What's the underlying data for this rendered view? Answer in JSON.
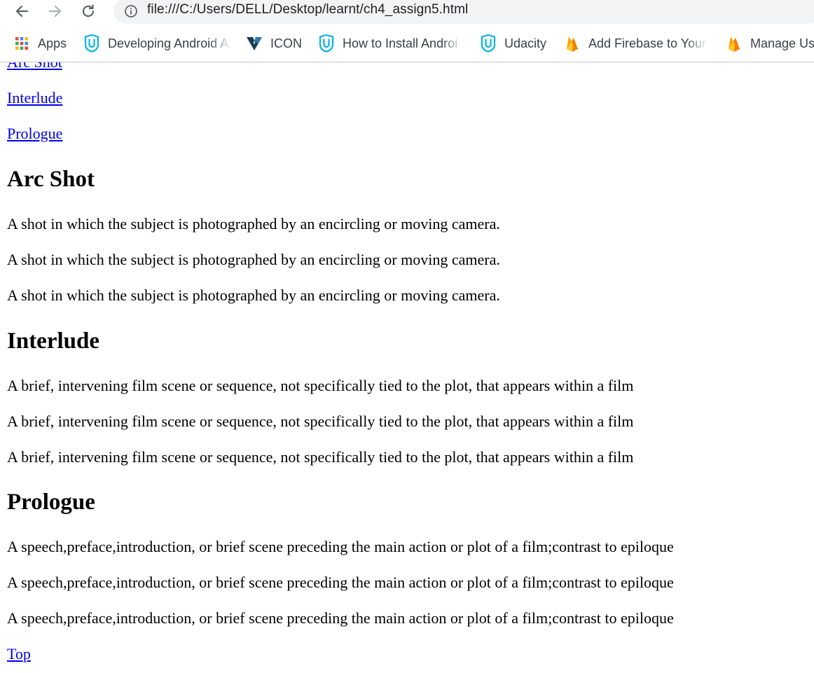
{
  "browser": {
    "url": "file:///C:/Users/DELL/Desktop/learnt/ch4_assign5.html",
    "bookmarks": [
      {
        "label": "Apps",
        "icon": "apps-grid-icon"
      },
      {
        "label": "Developing Android A",
        "icon": "udacity-icon"
      },
      {
        "label": "ICON",
        "icon": "vuetify-icon"
      },
      {
        "label": "How to Install Androi",
        "icon": "udacity-icon"
      },
      {
        "label": "Udacity",
        "icon": "udacity-icon"
      },
      {
        "label": "Add Firebase to Your",
        "icon": "firebase-icon"
      },
      {
        "label": "Manage Us",
        "icon": "firebase-icon"
      }
    ]
  },
  "page": {
    "nav_links": [
      "Arc Shot",
      "Interlude",
      "Prologue"
    ],
    "sections": [
      {
        "title": "Arc Shot",
        "paragraphs": [
          "A shot in which the subject is photographed by an encircling or moving camera.",
          "A shot in which the subject is photographed by an encircling or moving camera.",
          "A shot in which the subject is photographed by an encircling or moving camera."
        ]
      },
      {
        "title": "Interlude",
        "paragraphs": [
          "A brief, intervening film scene or sequence, not specifically tied to the plot, that appears within a film",
          "A brief, intervening film scene or sequence, not specifically tied to the plot, that appears within a film",
          "A brief, intervening film scene or sequence, not specifically tied to the plot, that appears within a film"
        ]
      },
      {
        "title": "Prologue",
        "paragraphs": [
          "A speech,preface,introduction, or brief scene preceding the main action or plot of a film;contrast to epiloque",
          "A speech,preface,introduction, or brief scene preceding the main action or plot of a film;contrast to epiloque",
          "A speech,preface,introduction, or brief scene preceding the main action or plot of a film;contrast to epiloque"
        ]
      }
    ],
    "top_link": "Top"
  },
  "colors": {
    "link": "#0000ee",
    "udacity_blue": "#02b3e4",
    "firebase_yellow": "#ffca28",
    "firebase_orange": "#f57c00"
  }
}
